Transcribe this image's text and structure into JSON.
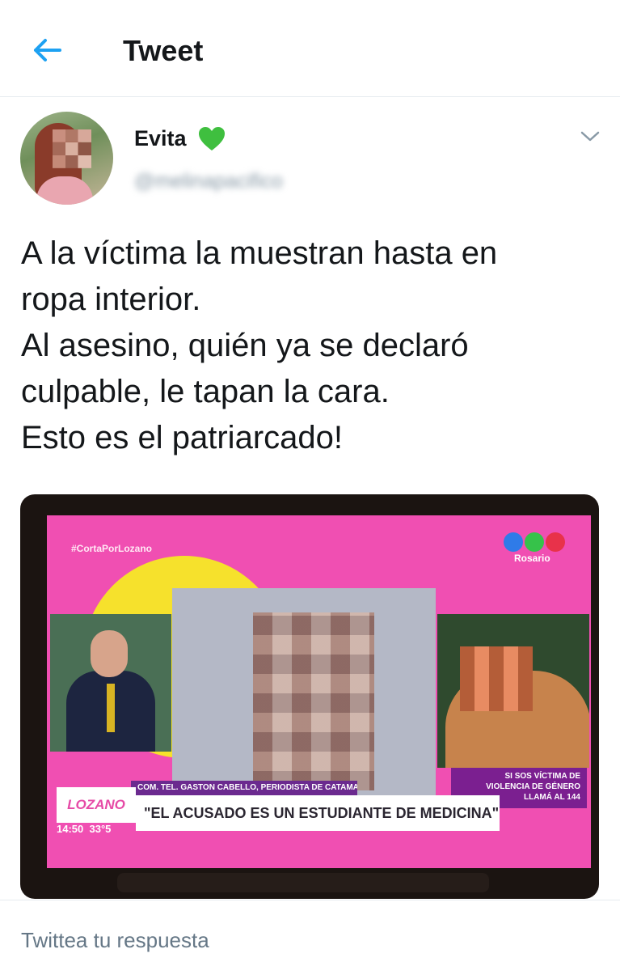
{
  "header": {
    "title": "Tweet",
    "back_icon": "arrow-left-icon",
    "accent_color": "#1da1f2"
  },
  "tweet": {
    "author": {
      "name": "Evita",
      "name_emoji": "green-heart-icon",
      "handle": "@melinapacifico",
      "handle_blurred": true
    },
    "menu_icon": "chevron-down-icon",
    "text_lines": [
      "A la víctima la muestran hasta en",
      "ropa interior.",
      "Al asesino, quién ya se declaró",
      "culpable, le tapan la cara.",
      "Esto es el patriarcado!"
    ]
  },
  "media": {
    "hashtag": "#CortaPorLozano",
    "city": "Rosario",
    "credit": "COM. TEL. GASTON CABELLO, PERIODISTA DE CATAMARCA",
    "headline": "\"EL ACUSADO ES UN ESTUDIANTE DE MEDICINA\"",
    "show_logo": "LOZANO",
    "time": "14:50",
    "temperature": "33°5",
    "help_lines": [
      "SI SOS VÍCTIMA DE",
      "VIOLENCIA DE GÉNERO",
      "LLAMÁ AL 144"
    ]
  },
  "reply": {
    "placeholder": "Twittea tu respuesta"
  }
}
